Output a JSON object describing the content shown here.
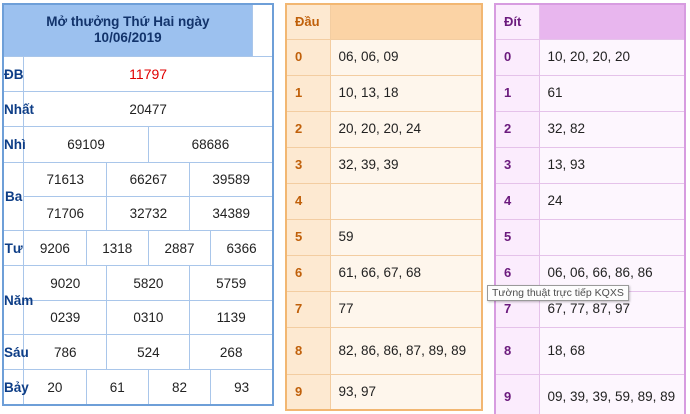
{
  "results": {
    "title_line1": "Mở thưởng Thứ Hai ngày",
    "title_line2": "10/06/2019",
    "prizes": [
      {
        "label": "ĐB",
        "values": [
          "11797"
        ]
      },
      {
        "label": "Nhất",
        "values": [
          "20477"
        ]
      },
      {
        "label": "Nhì",
        "values": [
          "69109",
          "68686"
        ]
      },
      {
        "label": "Ba",
        "values": [
          "71613",
          "66267",
          "39589",
          "71706",
          "32732",
          "34389"
        ]
      },
      {
        "label": "Tư",
        "values": [
          "9206",
          "1318",
          "2887",
          "6366"
        ]
      },
      {
        "label": "Năm",
        "values": [
          "9020",
          "5820",
          "5759",
          "0239",
          "0310",
          "1139"
        ]
      },
      {
        "label": "Sáu",
        "values": [
          "786",
          "524",
          "268"
        ]
      },
      {
        "label": "Bảy",
        "values": [
          "20",
          "61",
          "82",
          "93"
        ]
      }
    ]
  },
  "dau": {
    "header": "Đầu",
    "rows": [
      {
        "key": "0",
        "value": "06, 06, 09"
      },
      {
        "key": "1",
        "value": "10, 13, 18"
      },
      {
        "key": "2",
        "value": "20, 20, 20, 24"
      },
      {
        "key": "3",
        "value": "32, 39, 39"
      },
      {
        "key": "4",
        "value": ""
      },
      {
        "key": "5",
        "value": "59"
      },
      {
        "key": "6",
        "value": "61, 66, 67, 68"
      },
      {
        "key": "7",
        "value": "77"
      },
      {
        "key": "8",
        "value": "82, 86, 86, 87, 89, 89"
      },
      {
        "key": "9",
        "value": "93, 97"
      }
    ]
  },
  "dit": {
    "header": "Đít",
    "rows": [
      {
        "key": "0",
        "value": "10, 20, 20, 20"
      },
      {
        "key": "1",
        "value": "61"
      },
      {
        "key": "2",
        "value": "32, 82"
      },
      {
        "key": "3",
        "value": "13, 93"
      },
      {
        "key": "4",
        "value": "24"
      },
      {
        "key": "5",
        "value": ""
      },
      {
        "key": "6",
        "value": "06, 06, 66, 86, 86"
      },
      {
        "key": "7",
        "value": "67, 77, 87, 97"
      },
      {
        "key": "8",
        "value": "18, 68"
      },
      {
        "key": "9",
        "value": "09, 39, 39, 59, 89, 89"
      }
    ]
  },
  "tooltip": {
    "text": "Tường thuật trực tiếp KQXS"
  },
  "colors": {
    "results_header": "#9cc1ef",
    "results_border": "#6e9fd8",
    "special_prize": "#e00000",
    "dau_header": "#fbd3a5",
    "dit_header": "#e8b6ee"
  }
}
